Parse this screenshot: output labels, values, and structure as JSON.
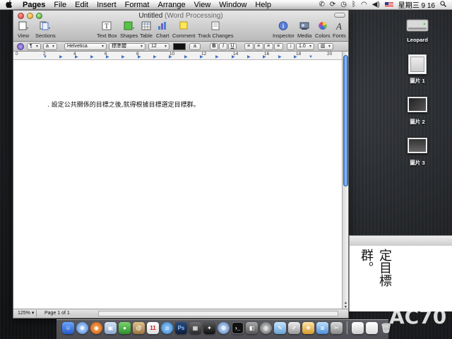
{
  "menubar": {
    "app": "Pages",
    "items": [
      "File",
      "Edit",
      "Insert",
      "Format",
      "Arrange",
      "View",
      "Window",
      "Help"
    ],
    "clock": "星期三 9 16"
  },
  "window": {
    "title": "Untitled",
    "subtitle": "(Word Processing)"
  },
  "toolbar": {
    "view": "View",
    "sections": "Sections",
    "text_box": "Text Box",
    "shapes": "Shapes",
    "table": "Table",
    "chart": "Chart",
    "comment": "Comment",
    "track_changes": "Track Changes",
    "inspector": "Inspector",
    "media": "Media",
    "colors": "Colors",
    "fonts": "Fonts"
  },
  "formatbar": {
    "paragraph_style_glyph": "¶",
    "char_style_glyph": "a",
    "font": "Helvetica",
    "typeface": "標準體",
    "size": "12",
    "char_glyph": "a",
    "bold": "B",
    "italic": "I",
    "underline": "U",
    "line_spacing": "1.0"
  },
  "ruler": {
    "numbers": [
      "0",
      "2",
      "4",
      "6",
      "8",
      "10",
      "12",
      "14",
      "16",
      "18",
      "20"
    ]
  },
  "document": {
    "text": ". 設定公共關係的目標之後,就得根據目標選定目標群。"
  },
  "statusbar": {
    "zoom": "125%",
    "page": "Page 1 of 1"
  },
  "desktop": {
    "icons": [
      {
        "label": "Leopard"
      },
      {
        "label": "圖片 1"
      },
      {
        "label": "圖片 2"
      },
      {
        "label": "圖片 3"
      }
    ],
    "preview_text": "定目標群。",
    "overlay_text": "AC70"
  },
  "colors": {
    "accent": "#3f7ed8",
    "title_gradient_top": "#e6e6e6"
  }
}
